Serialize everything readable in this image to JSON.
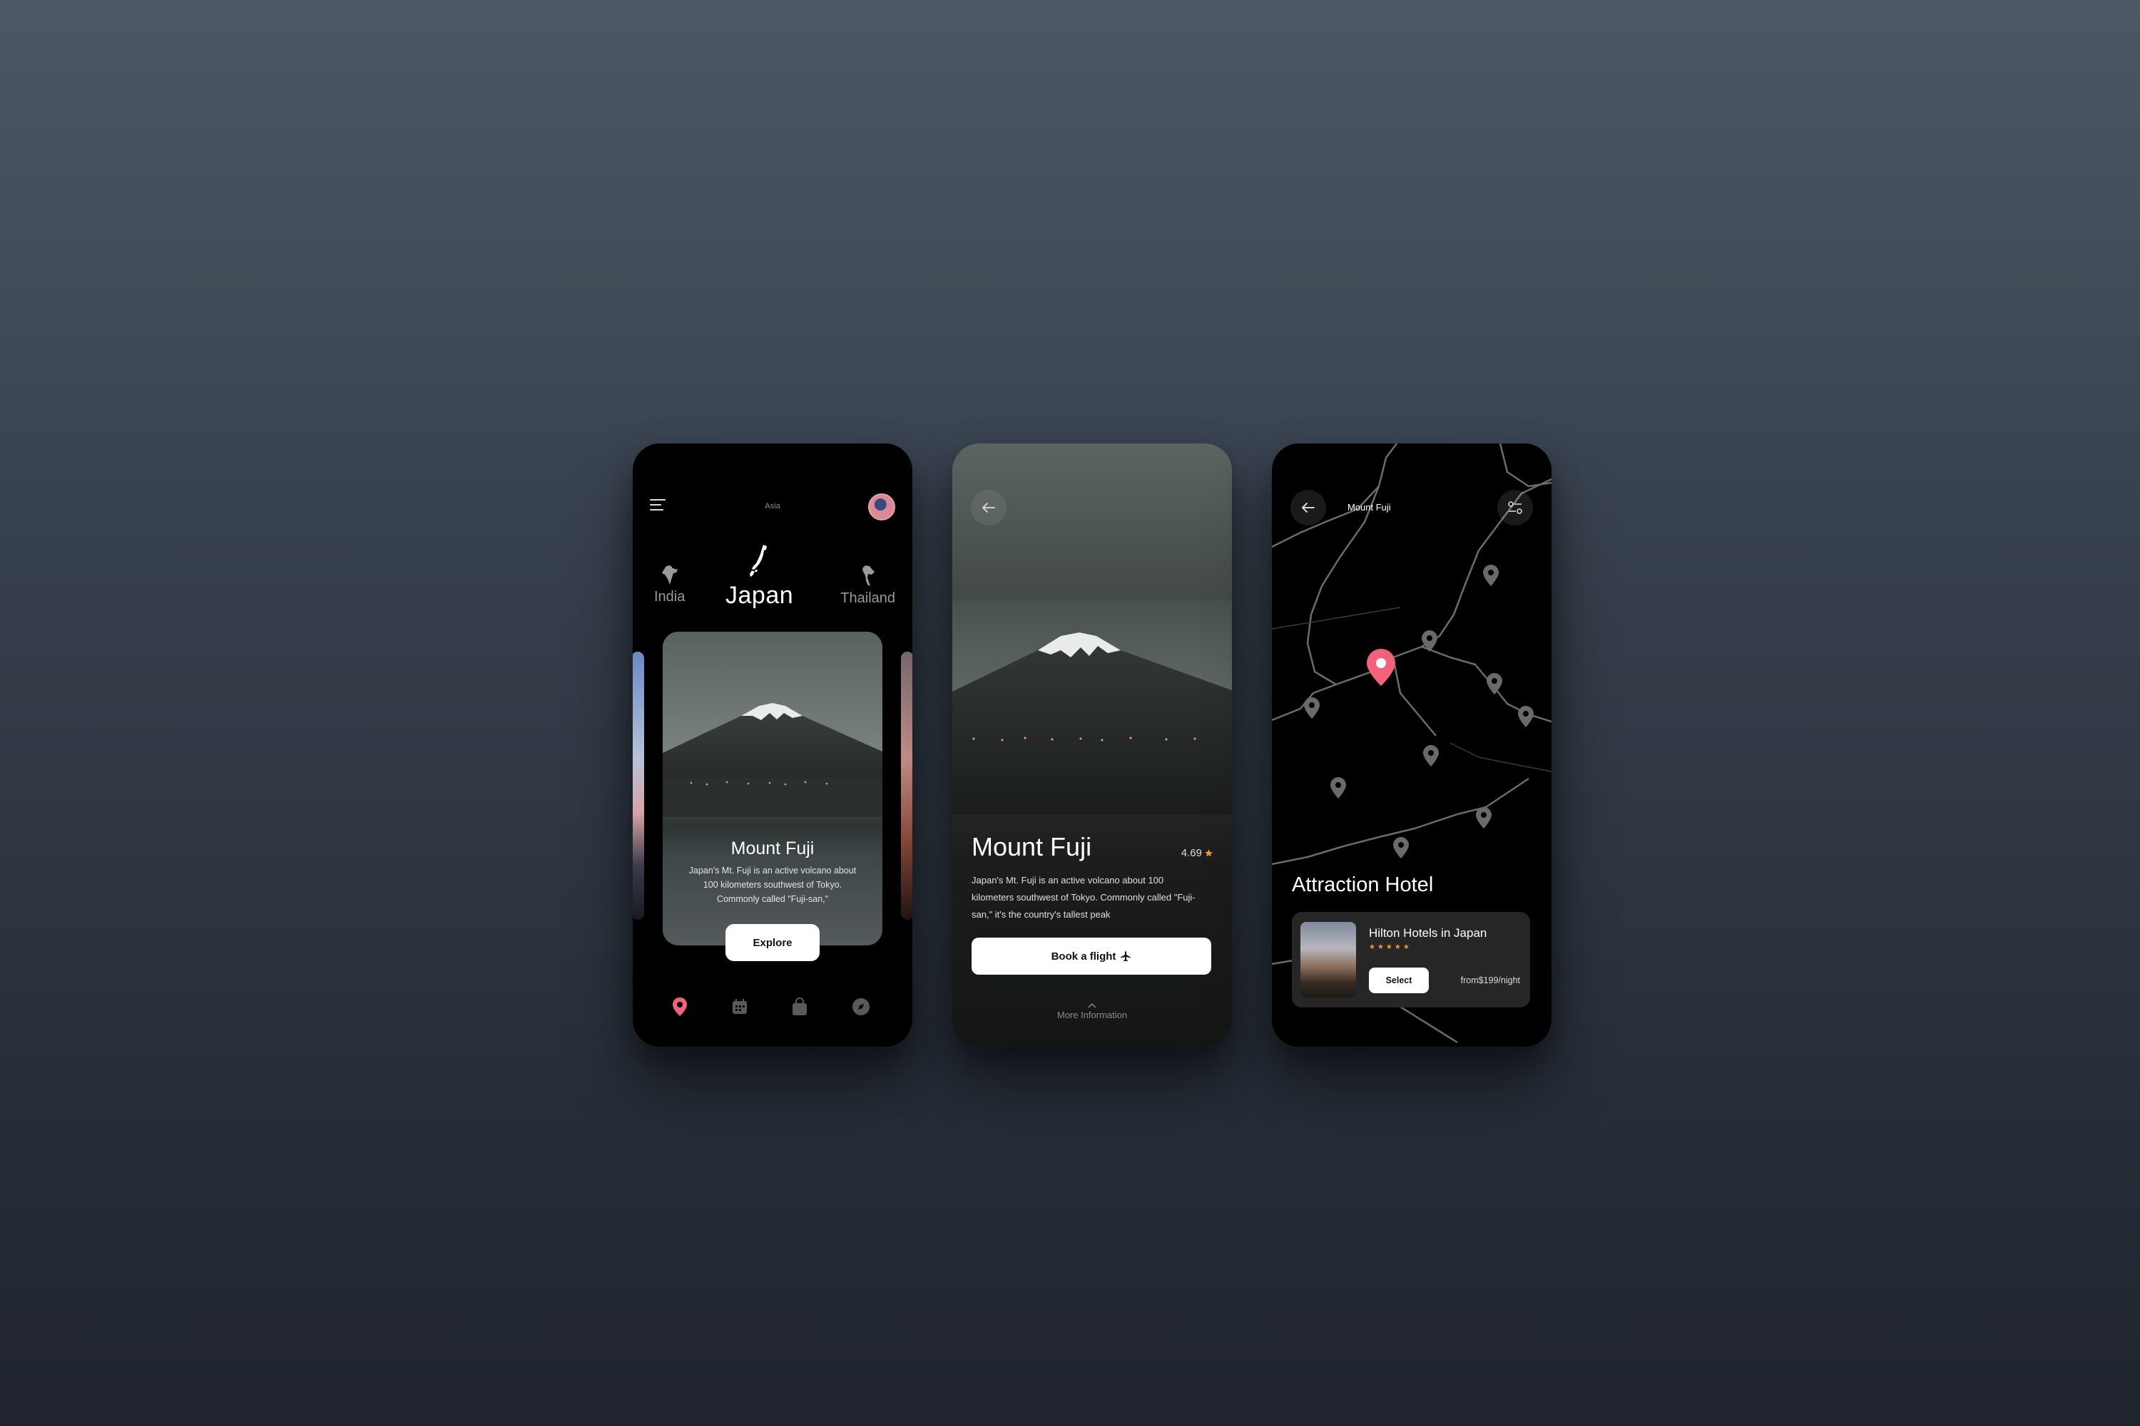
{
  "phone1": {
    "region": "Asia",
    "countries": [
      {
        "name": "India"
      },
      {
        "name": "Japan"
      },
      {
        "name": "Thailand"
      }
    ],
    "card": {
      "title": "Mount Fuji",
      "description": "Japan's Mt. Fuji is an active volcano about 100 kilometers southwest of Tokyo. Commonly called \"Fuji-san,\"",
      "button": "Explore"
    },
    "tabs": [
      "location-icon",
      "calendar-icon",
      "bag-icon",
      "compass-icon"
    ],
    "accent": "#f2637b"
  },
  "phone2": {
    "title": "Mount Fuji",
    "rating": "4.69",
    "description": "Japan's Mt. Fuji is an active volcano about 100 kilometers southwest of Tokyo. Commonly called \"Fuji-san,\" it's the country's tallest peak",
    "book_button": "Book a flight",
    "more_info": "More Information",
    "star_color": "#f29a2e"
  },
  "phone3": {
    "title": "Mount Fuji",
    "section_title": "Attraction Hotel",
    "hotel": {
      "name": "Hilton Hotels in Japan",
      "stars": 5,
      "select_button": "Select",
      "price": "from$199/night"
    }
  }
}
